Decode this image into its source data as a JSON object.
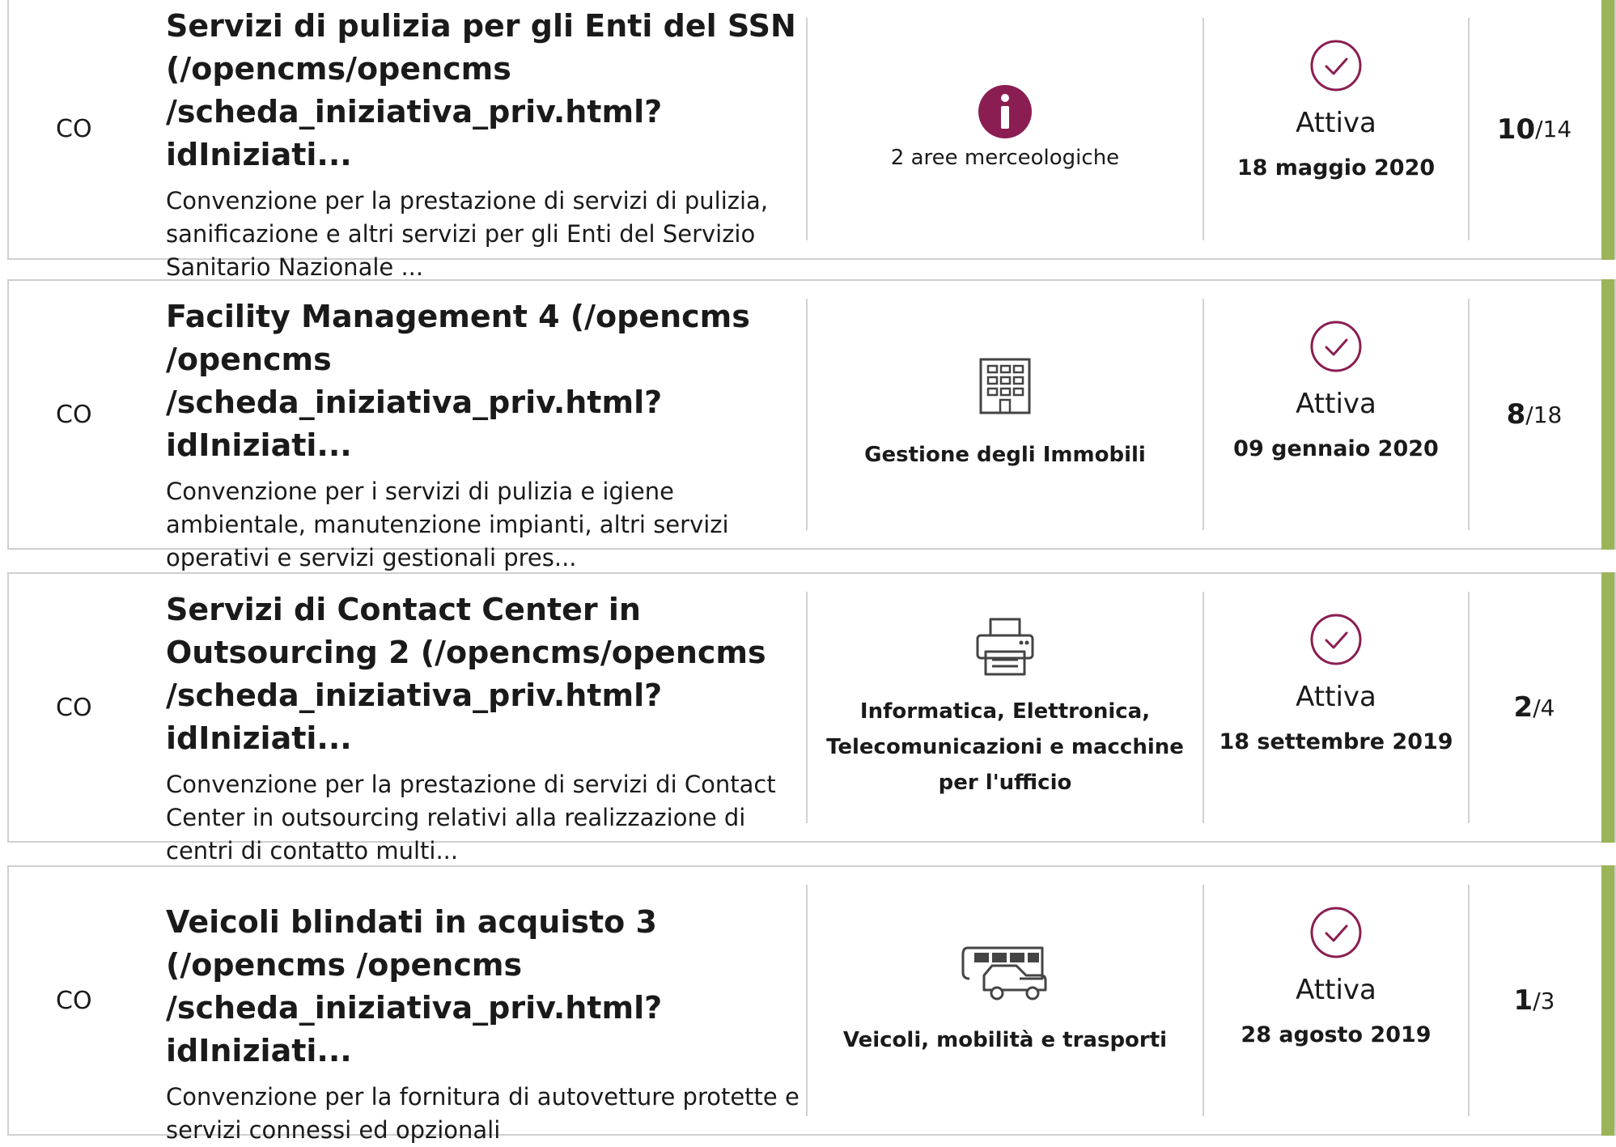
{
  "colors": {
    "accent": "#8a1e52",
    "status_bar": "#9bb45a",
    "border": "#cfcfcf"
  },
  "items": [
    {
      "type": "CO",
      "title": "Servizi di pulizia per gli Enti del SSN (/opencms/opencms /scheda_iniziativa_priv.html?idIniziati...",
      "description": "Convenzione per la prestazione di servizi di pulizia, sanificazione e altri servizi per gli Enti del Servizio Sanitario Nazionale ...",
      "category_icon": "info-icon",
      "category_label": "2 aree merceologiche",
      "status": "Attiva",
      "date": "18 maggio 2020",
      "count_current": "10",
      "count_total": "/14"
    },
    {
      "type": "CO",
      "title": "Facility Management 4 (/opencms /opencms /scheda_iniziativa_priv.html?idIniziati...",
      "description": "Convenzione per i servizi di pulizia e igiene ambientale, manutenzione impianti, altri servizi operativi e servizi gestionali pres...",
      "category_icon": "building-icon",
      "category_label": "Gestione degli Immobili",
      "status": "Attiva",
      "date": "09 gennaio 2020",
      "count_current": "8",
      "count_total": "/18"
    },
    {
      "type": "CO",
      "title": "Servizi di Contact Center in Outsourcing 2 (/opencms/opencms /scheda_iniziativa_priv.html?idIniziati...",
      "description": "Convenzione per la prestazione di servizi di Contact Center in outsourcing relativi alla realizzazione di centri di contatto multi...",
      "category_icon": "printer-icon",
      "category_label": "Informatica, Elettronica, Telecomunicazioni e macchine per l'ufficio",
      "status": "Attiva",
      "date": "18 settembre 2019",
      "count_current": "2",
      "count_total": "/4"
    },
    {
      "type": "CO",
      "title": "Veicoli blindati in acquisto 3 (/opencms /opencms /scheda_iniziativa_priv.html?idIniziati...",
      "description": "Convenzione per la fornitura di autovetture protette e servizi connessi ed opzionali",
      "category_icon": "vehicles-icon",
      "category_label": "Veicoli, mobilità e trasporti",
      "status": "Attiva",
      "date": "28 agosto 2019",
      "count_current": "1",
      "count_total": "/3"
    }
  ]
}
